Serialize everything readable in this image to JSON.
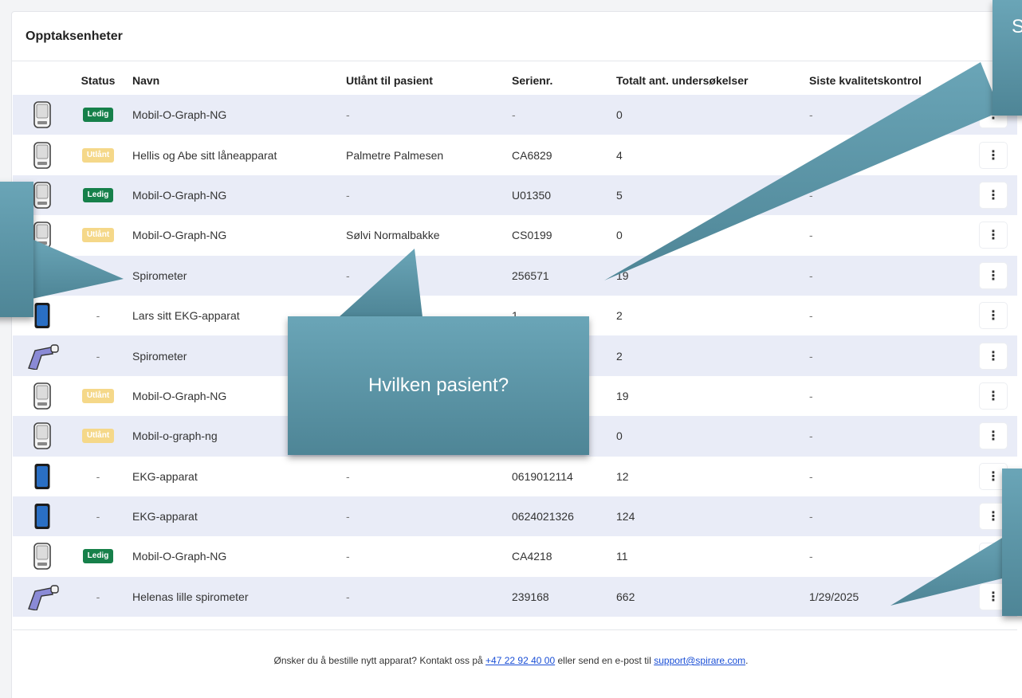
{
  "page": {
    "title": "Opptaksenheter"
  },
  "table": {
    "headers": {
      "status": "Status",
      "name": "Navn",
      "loaned": "Utlånt til pasient",
      "serial": "Serienr.",
      "total": "Totalt ant. undersøkelser",
      "qc": "Siste kvalitetskontrol"
    },
    "rows": [
      {
        "icon": "bp-monitor-icon",
        "status": "Ledig",
        "name": "Mobil-O-Graph-NG",
        "loaned": "-",
        "serial": "-",
        "total": "0",
        "qc": "-"
      },
      {
        "icon": "bp-monitor-icon",
        "status": "Utlånt",
        "name": "Hellis og Abe sitt låneapparat",
        "loaned": "Palmetre Palmesen",
        "serial": "CA6829",
        "total": "4",
        "qc": ""
      },
      {
        "icon": "bp-monitor-icon",
        "status": "Ledig",
        "name": "Mobil-O-Graph-NG",
        "loaned": "-",
        "serial": "U01350",
        "total": "5",
        "qc": "-"
      },
      {
        "icon": "bp-monitor-icon",
        "status": "Utlånt",
        "name": "Mobil-O-Graph-NG",
        "loaned": "Sølvi Normalbakke",
        "serial": "CS0199",
        "total": "0",
        "qc": "-"
      },
      {
        "icon": "spirometer-icon",
        "status": "-",
        "name": "Spirometer",
        "loaned": "-",
        "serial": "256571",
        "total": "19",
        "qc": "-"
      },
      {
        "icon": "ekg-device-icon",
        "status": "-",
        "name": "Lars sitt EKG-apparat",
        "loaned": "",
        "serial": "1",
        "total": "2",
        "qc": "-"
      },
      {
        "icon": "spirometer-icon",
        "status": "-",
        "name": "Spirometer",
        "loaned": "",
        "serial": "",
        "total": "2",
        "qc": "-"
      },
      {
        "icon": "bp-monitor-icon",
        "status": "Utlånt",
        "name": "Mobil-O-Graph-NG",
        "loaned": "",
        "serial": "",
        "total": "19",
        "qc": "-"
      },
      {
        "icon": "bp-monitor-icon",
        "status": "Utlånt",
        "name": "Mobil-o-graph-ng",
        "loaned": "",
        "serial": "",
        "total": "0",
        "qc": "-"
      },
      {
        "icon": "ekg-device-icon",
        "status": "-",
        "name": "EKG-apparat",
        "loaned": "-",
        "serial": "0619012114",
        "total": "12",
        "qc": "-"
      },
      {
        "icon": "ekg-device-icon",
        "status": "-",
        "name": "EKG-apparat",
        "loaned": "-",
        "serial": "0624021326",
        "total": "124",
        "qc": "-"
      },
      {
        "icon": "bp-monitor-icon",
        "status": "Ledig",
        "name": "Mobil-O-Graph-NG",
        "loaned": "-",
        "serial": "CA4218",
        "total": "11",
        "qc": "-"
      },
      {
        "icon": "spirometer-icon",
        "status": "-",
        "name": "Helenas lille spirometer",
        "loaned": "-",
        "serial": "239168",
        "total": "662",
        "qc": "1/29/2025"
      }
    ],
    "menu_glyph": "⋮"
  },
  "footer": {
    "text_before": "Ønsker du å bestille nytt apparat? Kontakt oss på ",
    "phone": "+47 22 92 40 00",
    "text_middle": " eller send en e-post til ",
    "email": "support@spirare.com",
    "text_after": "."
  },
  "callouts": {
    "center": "Hvilken pasient?",
    "top_right": "S"
  },
  "colors": {
    "row_alt": "#e9ecf7",
    "ledig": "#16804a",
    "utlant": "#f5d889",
    "callout": "#5b95a7",
    "link": "#1a4fd6"
  }
}
